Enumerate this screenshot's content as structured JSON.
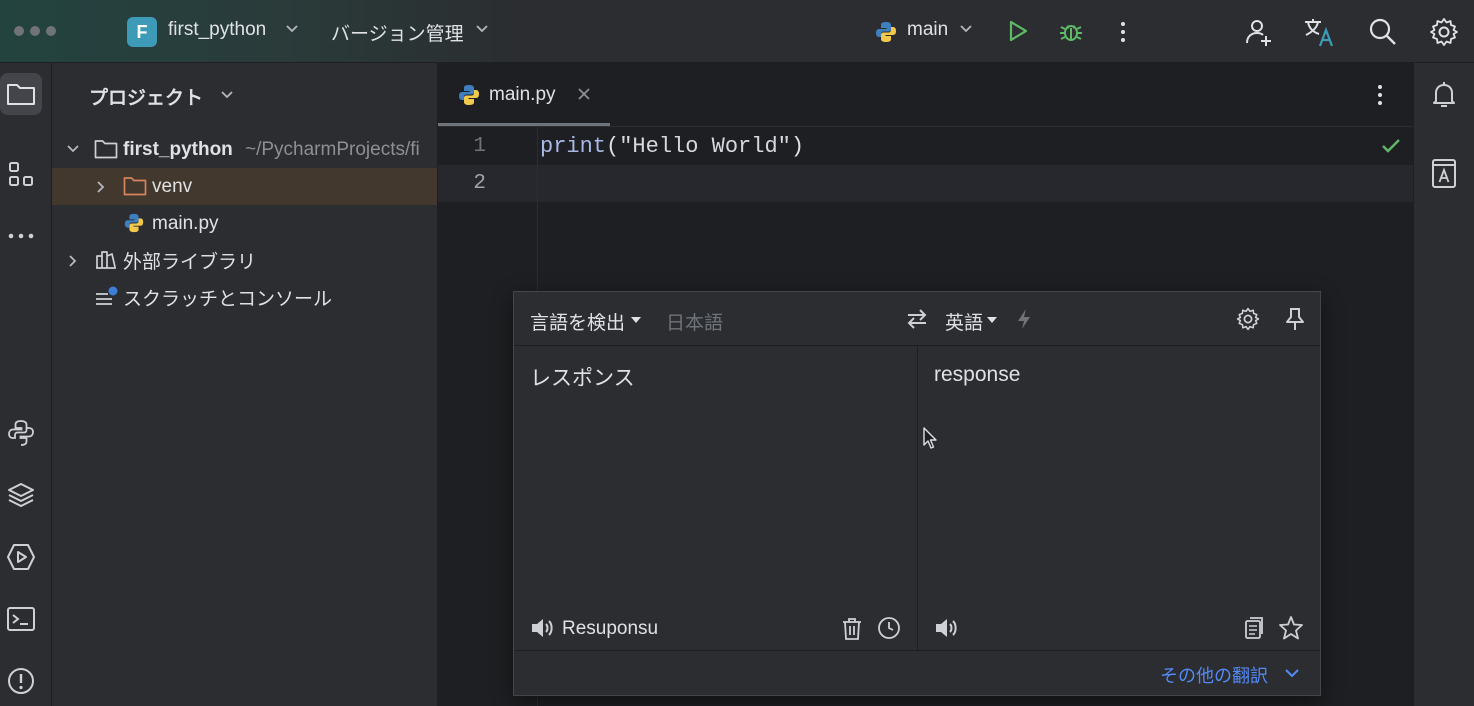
{
  "titlebar": {
    "project_initial": "F",
    "project_name": "first_python",
    "vcs_label": "バージョン管理",
    "run_config": "main"
  },
  "project_panel": {
    "title": "プロジェクト",
    "tree": {
      "root_name": "first_python",
      "root_path": "~/PycharmProjects/fi",
      "venv": "venv",
      "main_file": "main.py",
      "external_libs": "外部ライブラリ",
      "scratches": "スクラッチとコンソール"
    }
  },
  "editor": {
    "tab_label": "main.py",
    "lines": [
      {
        "num": "1",
        "func": "print",
        "open": "(",
        "string": "\"Hello World\"",
        "close": ")"
      },
      {
        "num": "2"
      }
    ]
  },
  "translator": {
    "source_lang": "言語を検出",
    "detected_lang": "日本語",
    "target_lang": "英語",
    "source_text": "レスポンス",
    "target_text": "response",
    "transliteration": "Resuponsu",
    "more_translations": "その他の翻訳"
  },
  "colors": {
    "accent": "#548af7",
    "success": "#5fb865",
    "keyword": "#a9b7e6",
    "string": "#d5d8de",
    "folder": "#d6855e"
  }
}
